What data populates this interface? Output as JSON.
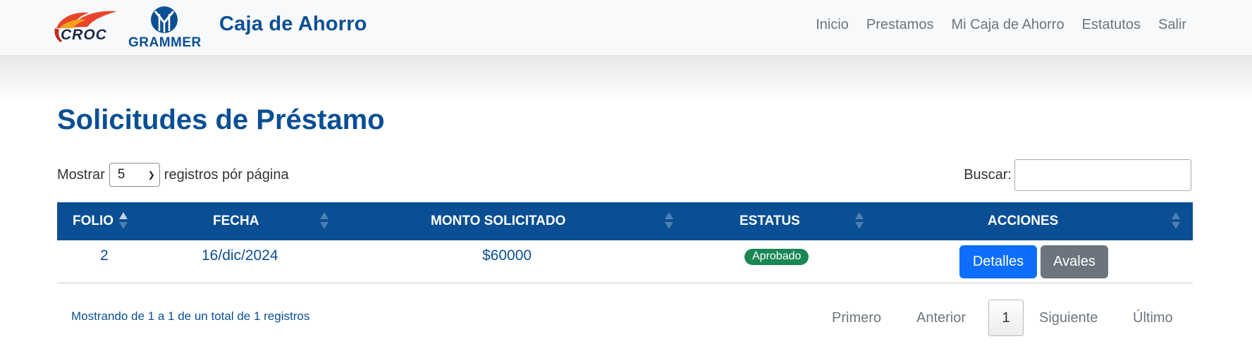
{
  "brand": {
    "logo_croc": "CROC",
    "logo_grammer": "GRAMMER",
    "title": "Caja de Ahorro"
  },
  "nav": [
    {
      "label": "Inicio"
    },
    {
      "label": "Prestamos"
    },
    {
      "label": "Mi Caja de Ahorro"
    },
    {
      "label": "Estatutos"
    },
    {
      "label": "Salir"
    }
  ],
  "page": {
    "title": "Solicitudes de Préstamo"
  },
  "length": {
    "prefix": "Mostrar",
    "value": "5",
    "suffix": "registros pór página"
  },
  "search": {
    "label": "Buscar:",
    "value": ""
  },
  "table": {
    "columns": [
      "FOLIO",
      "FECHA",
      "MONTO SOLICITADO",
      "ESTATUS",
      "ACCIONES"
    ],
    "rows": [
      {
        "folio": "2",
        "fecha": "16/dic/2024",
        "monto": "$60000",
        "estatus": "Aprobado",
        "actions": [
          "Detalles",
          "Avales"
        ]
      }
    ]
  },
  "info": "Mostrando de 1 a 1 de un total de 1 registros",
  "pagination": {
    "first": "Primero",
    "previous": "Anterior",
    "current": "1",
    "next": "Siguiente",
    "last": "Último"
  },
  "colors": {
    "primary": "#0a4f94",
    "badge_success": "#198754",
    "btn_primary": "#0d6efd",
    "btn_secondary": "#6c757d"
  }
}
